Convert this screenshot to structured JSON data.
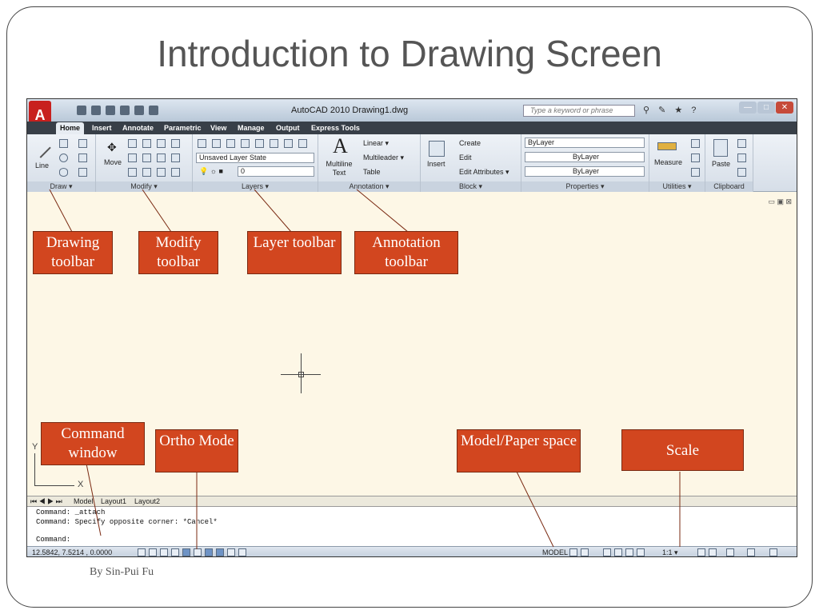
{
  "slide": {
    "title": "Introduction to Drawing Screen",
    "footer": "By Sin-Pui Fu"
  },
  "autocad": {
    "title_text": "AutoCAD 2010    Drawing1.dwg",
    "search_placeholder": "Type a keyword or phrase",
    "tabs": [
      "Home",
      "Insert",
      "Annotate",
      "Parametric",
      "View",
      "Manage",
      "Output",
      "Express Tools"
    ],
    "ribbon": {
      "draw": {
        "line": "Line",
        "label": "Draw ▾"
      },
      "modify": {
        "move": "Move",
        "label": "Modify ▾"
      },
      "layers": {
        "layer_state": "Unsaved Layer State",
        "layer_current": "0",
        "label": "Layers ▾"
      },
      "annotation": {
        "multiline_text": "Multiline Text",
        "linear": "Linear ▾",
        "multileader": "Multileader ▾",
        "table": "Table",
        "label": "Annotation ▾"
      },
      "block": {
        "insert": "Insert",
        "create": "Create",
        "edit": "Edit",
        "edit_attributes": "Edit Attributes ▾",
        "label": "Block ▾"
      },
      "properties": {
        "color": "ByLayer",
        "linetype": "ByLayer",
        "lineweight": "ByLayer",
        "label": "Properties ▾"
      },
      "utilities": {
        "measure": "Measure",
        "label": "Utilities ▾"
      },
      "clipboard": {
        "paste": "Paste",
        "label": "Clipboard"
      }
    },
    "ucs": {
      "x": "X",
      "y": "Y"
    },
    "layout_tabs": {
      "model": "Model",
      "layout1": "Layout1",
      "layout2": "Layout2"
    },
    "command_lines": [
      "Command: _attach",
      "Command: Specify opposite corner: *Cancel*",
      "Command:"
    ],
    "status": {
      "coords": "12.5842, 7.5214 , 0.0000",
      "model": "MODEL",
      "scale": "1:1 ▾"
    }
  },
  "callouts": {
    "drawing_toolbar": "Drawing toolbar",
    "modify_toolbar": "Modify toolbar",
    "layer_toolbar": "Layer toolbar",
    "annotation_toolbar": "Annotation toolbar",
    "command_window": "Command window",
    "ortho_mode": "Ortho Mode",
    "model_paper_space": "Model/Paper space",
    "scale": "Scale"
  }
}
